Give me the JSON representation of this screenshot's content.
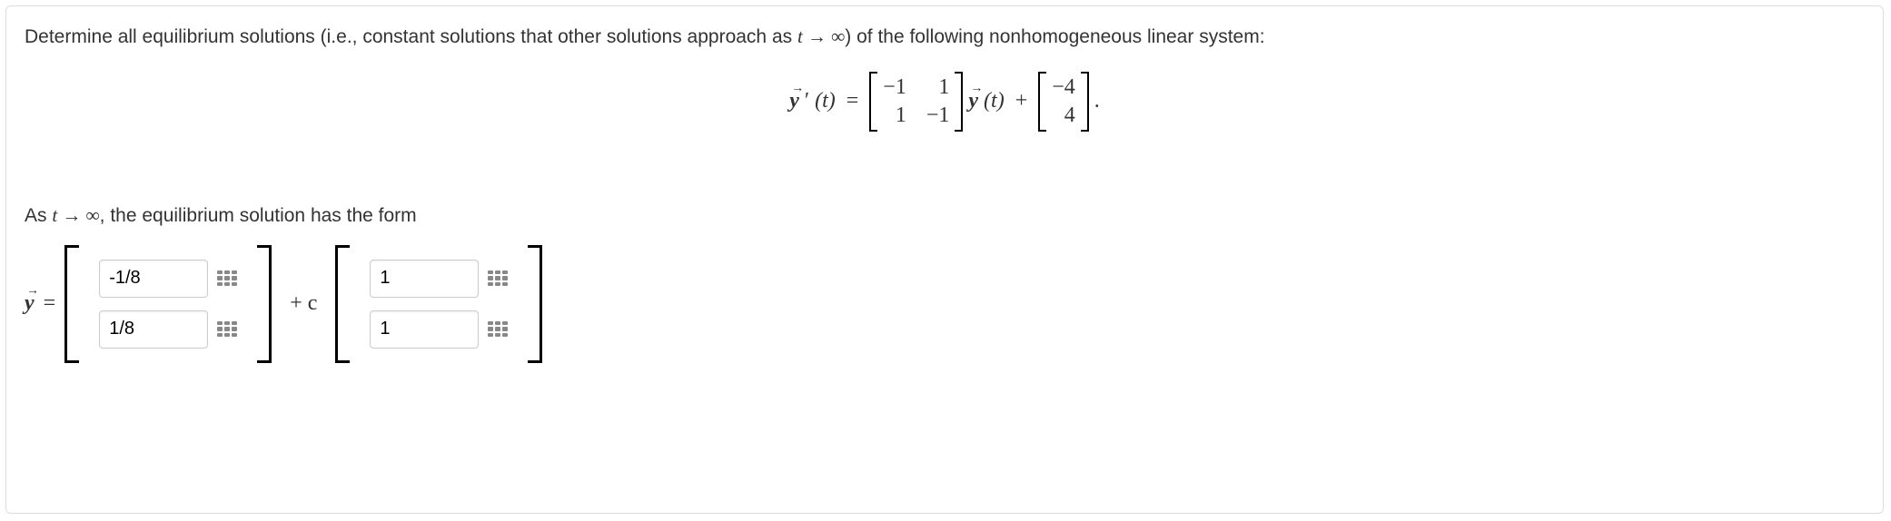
{
  "question": {
    "intro_pre": "Determine all equilibrium solutions (i.e., constant solutions that other solutions approach as ",
    "limit_expr": "t → ∞",
    "intro_post": ") of the following nonhomogeneous linear system:"
  },
  "equation": {
    "lhs_symbol": "y",
    "lhs_prime": "′",
    "lhs_arg": "(t)",
    "equals": "=",
    "matrix_A": {
      "r1c1": "−1",
      "r1c2": "1",
      "r2c1": "1",
      "r2c2": "−1"
    },
    "yt": "(t)",
    "plus": "+",
    "vector_b": {
      "r1": "−4",
      "r2": "4"
    },
    "period": "."
  },
  "prompt2": {
    "pre": "As ",
    "limit_expr": "t → ∞",
    "post": ", the equilibrium solution has the form"
  },
  "answer": {
    "y_symbol": "y",
    "equals": "=",
    "vec1": {
      "v1": "-1/8",
      "v2": "1/8"
    },
    "plus_c": "+ c",
    "vec2": {
      "v1": "1",
      "v2": "1"
    }
  },
  "icons": {
    "keypad": "keypad-icon"
  }
}
